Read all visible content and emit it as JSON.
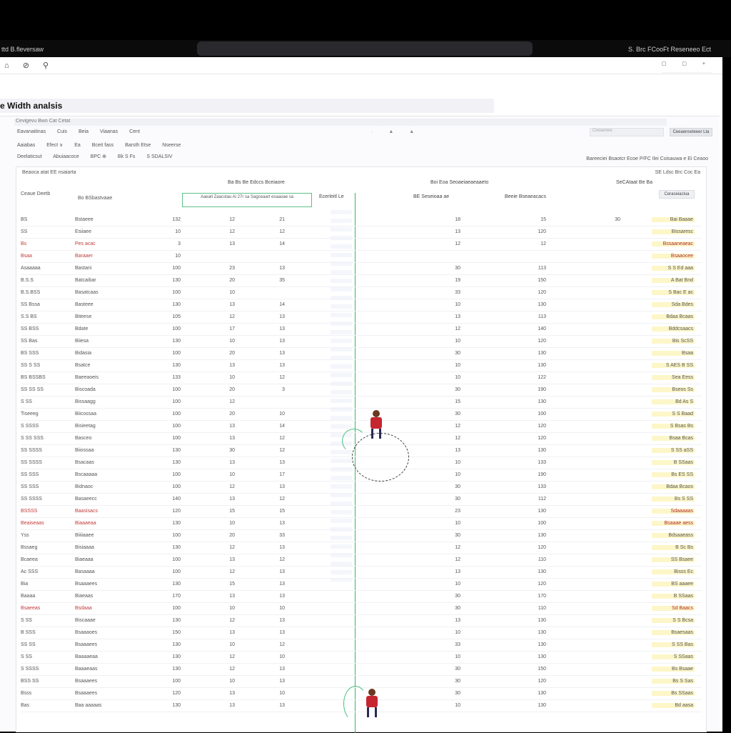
{
  "os_bar": {
    "left": "ttd B.fleversaw",
    "right": "S. Brc FCooFt Reseneeo  Ect"
  },
  "toolbar": {
    "left_icons": "⌂ ⊘ ⚲",
    "right_icons": "▢ ▢ +"
  },
  "page_title": "e Width analsis",
  "crumb": {
    "text": "Cevigevu Bwo Cat Cetat"
  },
  "filters_row1": [
    "Eavanaitinas",
    "Cuis",
    "Beia",
    "Viaanas",
    "Cent"
  ],
  "filters_row2": [
    "Aaiabas",
    "Efect ∨",
    "Ea",
    "Bceit fass",
    "Barsth Etse",
    "Nseerse"
  ],
  "filters_row3": [
    "Deelaticsut",
    "Abuiaacoce",
    "BPC ⊕",
    "Bk S Fs",
    "S SDALSIV"
  ],
  "search_placeholder": "Ceeaenee",
  "right_button": "Ceeaenseteeer Lta",
  "right_meta": "Bareeciei Bsaotcr Ecoe P/FC Ilei Coisauwa e Ei Ceaoo",
  "table": {
    "subhead": "Beaoca atat  EE nsaiarta",
    "subhead_right": "SE Ldsc Brc Coc Ea",
    "hdr3": "Ceaue Deetb",
    "header_button": "Ceraseiaclua",
    "green_box": "Aaeatl Zaacstau Ai 27r sa Sagceaart  esaaoae sa",
    "mid_header": "Ecerleitl Le",
    "col_header_a": "Bo BSbastvaae",
    "col_header_b": "BE Seseioaa ae",
    "col_header_c": "Ba Bs Be Edccs Bceiaore",
    "col_header_d": "Beeie Bseaeacacs",
    "col_header_e": "Boi Eoa Seoaeiaeaeaaeto",
    "col_header_f": "SeCAtaat Be Ba"
  },
  "rows": [
    {
      "a": "BS",
      "b": "Bstaeee",
      "c": "132",
      "d": "12",
      "e": "21",
      "f": "30",
      "g": "18",
      "h": "15",
      "score": "Bai Baaae",
      "red": false
    },
    {
      "a": "SS",
      "b": "Esiiaee",
      "c": "10",
      "d": "12",
      "e": "12",
      "f": "",
      "g": "13",
      "h": "120",
      "score": "Bissaresc",
      "red": false
    },
    {
      "a": "Bs",
      "b": "Pes acac",
      "c": "3",
      "d": "13",
      "e": "14",
      "f": "",
      "g": "12",
      "h": "12",
      "score": "Bssaaneaeac",
      "red": true
    },
    {
      "a": "Bsaa",
      "b": "Baraaer",
      "c": "10",
      "d": "",
      "e": "",
      "f": "",
      "g": "",
      "h": "",
      "score": "Bsaaocee",
      "red": true
    },
    {
      "a": "Asaaaaa",
      "b": "Bastani",
      "c": "100",
      "d": "23",
      "e": "13",
      "f": "",
      "g": "30",
      "h": "113",
      "score": "S S Ed aaa",
      "red": false
    },
    {
      "a": "B.S.S",
      "b": "Batcaibar",
      "c": "130",
      "d": "20",
      "e": "35",
      "f": "",
      "g": "19",
      "h": "150",
      "score": "A Bat Bnd",
      "red": false
    },
    {
      "a": "B.S.BSS",
      "b": "Basatcaas",
      "c": "100",
      "d": "10",
      "e": "",
      "f": "",
      "g": "33",
      "h": "120",
      "score": "S Bac E ac",
      "red": false
    },
    {
      "a": "SS Bssa",
      "b": "Basteee",
      "c": "130",
      "d": "13",
      "e": "14",
      "f": "",
      "g": "10",
      "h": "130",
      "score": "Sda Bdes",
      "red": false
    },
    {
      "a": "S.S BS",
      "b": "Biteese",
      "c": "105",
      "d": "12",
      "e": "13",
      "f": "",
      "g": "13",
      "h": "113",
      "score": "Bdaa Bcaas",
      "red": false
    },
    {
      "a": "SS BSS",
      "b": "Bdate",
      "c": "100",
      "d": "17",
      "e": "13",
      "f": "",
      "g": "12",
      "h": "140",
      "score": "Bddcsaacs",
      "red": false
    },
    {
      "a": "SS Bas",
      "b": "Biiesa",
      "c": "130",
      "d": "10",
      "e": "13",
      "f": "",
      "g": "10",
      "h": "120",
      "score": "Bis ScSS",
      "red": false
    },
    {
      "a": "BS SSS",
      "b": "Bidasia",
      "c": "100",
      "d": "20",
      "e": "13",
      "f": "",
      "g": "30",
      "h": "130",
      "score": "Bsaa",
      "red": false
    },
    {
      "a": "SS S SS",
      "b": "Bsatce",
      "c": "130",
      "d": "13",
      "e": "13",
      "f": "",
      "g": "10",
      "h": "130",
      "score": "S AES B SS",
      "red": false
    },
    {
      "a": "BS BSSBS",
      "b": "Baeeaoeis",
      "c": "133",
      "d": "10",
      "e": "12",
      "f": "",
      "g": "10",
      "h": "122",
      "score": "Sea Eess",
      "red": false
    },
    {
      "a": "SS SS SS",
      "b": "Biscoada",
      "c": "100",
      "d": "20",
      "e": "3",
      "f": "",
      "g": "30",
      "h": "190",
      "score": "Bseos Ss",
      "red": false
    },
    {
      "a": "S SS",
      "b": "Bissaagg",
      "c": "100",
      "d": "12",
      "e": "",
      "f": "",
      "g": "15",
      "h": "130",
      "score": "Bd As S",
      "red": false
    },
    {
      "a": "Tiseeeg",
      "b": "Biicossaa",
      "c": "100",
      "d": "20",
      "e": "10",
      "f": "",
      "g": "30",
      "h": "100",
      "score": "S S Baad",
      "red": false
    },
    {
      "a": "S SSSS",
      "b": "Bisieetag",
      "c": "100",
      "d": "13",
      "e": "14",
      "f": "",
      "g": "12",
      "h": "120",
      "score": "S Bsas Bs",
      "red": false
    },
    {
      "a": "S SS SSS",
      "b": "Basceo",
      "c": "100",
      "d": "13",
      "e": "12",
      "f": "",
      "g": "12",
      "h": "120",
      "score": "Bsaa Bcas",
      "red": false
    },
    {
      "a": "SS SSSS",
      "b": "Biiossaa",
      "c": "130",
      "d": "30",
      "e": "12",
      "f": "",
      "g": "13",
      "h": "130",
      "score": "S SS aSS",
      "red": false
    },
    {
      "a": "SS SSSS",
      "b": "Bsacaas",
      "c": "130",
      "d": "13",
      "e": "13",
      "f": "",
      "g": "10",
      "h": "133",
      "score": "B SSaas",
      "red": false
    },
    {
      "a": "SS SSS",
      "b": "Bscaaaaa",
      "c": "100",
      "d": "10",
      "e": "17",
      "f": "",
      "g": "10",
      "h": "190",
      "score": "Bs ES SS",
      "red": false
    },
    {
      "a": "SS SSS",
      "b": "Bidnaoc",
      "c": "100",
      "d": "12",
      "e": "13",
      "f": "",
      "g": "30",
      "h": "133",
      "score": "Bdaa Bcaos",
      "red": false
    },
    {
      "a": "SS SSSS",
      "b": "Basaeecc",
      "c": "140",
      "d": "13",
      "e": "12",
      "f": "",
      "g": "30",
      "h": "112",
      "score": "Bs S SS",
      "red": false
    },
    {
      "a": "BSSSS",
      "b": "Baasisacs",
      "c": "120",
      "d": "15",
      "e": "15",
      "f": "",
      "g": "23",
      "h": "130",
      "score": "Sdaaaaas",
      "red": true
    },
    {
      "a": "Beaiseaas",
      "b": "Biaaaeaa",
      "c": "130",
      "d": "10",
      "e": "13",
      "f": "",
      "g": "10",
      "h": "100",
      "score": "Bsaaae aess",
      "red": true
    },
    {
      "a": "Yss",
      "b": "Biiiiaaee",
      "c": "100",
      "d": "20",
      "e": "33",
      "f": "",
      "g": "30",
      "h": "130",
      "score": "Bdsaaeass",
      "red": false
    },
    {
      "a": "Bssaeg",
      "b": "Bisiaaaa",
      "c": "130",
      "d": "12",
      "e": "13",
      "f": "",
      "g": "12",
      "h": "120",
      "score": "B Sc Bs",
      "red": false
    },
    {
      "a": "Bcaeea",
      "b": "Biaeaaa",
      "c": "100",
      "d": "13",
      "e": "12",
      "f": "",
      "g": "12",
      "h": "110",
      "score": "SS Bsaee",
      "red": false
    },
    {
      "a": "Ac SSS",
      "b": "Basaaaa",
      "c": "100",
      "d": "12",
      "e": "13",
      "f": "",
      "g": "13",
      "h": "130",
      "score": "Bisss Ec",
      "red": false
    },
    {
      "a": "Bia",
      "b": "Bsaaaees",
      "c": "130",
      "d": "15",
      "e": "13",
      "f": "",
      "g": "10",
      "h": "120",
      "score": "BS aaaee",
      "red": false
    },
    {
      "a": "Baaaa",
      "b": "Biaeaas",
      "c": "170",
      "d": "13",
      "e": "13",
      "f": "",
      "g": "30",
      "h": "170",
      "score": "B SSaas",
      "red": false
    },
    {
      "a": "Bsaeeas",
      "b": "Bsdaaa",
      "c": "100",
      "d": "10",
      "e": "10",
      "f": "",
      "g": "30",
      "h": "110",
      "score": "Sd Baacs",
      "red": true
    },
    {
      "a": "S SS",
      "b": "Biscaaae",
      "c": "130",
      "d": "12",
      "e": "13",
      "f": "",
      "g": "13",
      "h": "130",
      "score": "S S Bcsa",
      "red": false
    },
    {
      "a": "B SSS",
      "b": "Bsaaaoes",
      "c": "150",
      "d": "13",
      "e": "13",
      "f": "",
      "g": "10",
      "h": "130",
      "score": "Bsaesaas",
      "red": false
    },
    {
      "a": "SS SS",
      "b": "Bsaaaees",
      "c": "130",
      "d": "10",
      "e": "12",
      "f": "",
      "g": "33",
      "h": "130",
      "score": "S SS Bas",
      "red": false
    },
    {
      "a": "S SS",
      "b": "Baaaaeaa",
      "c": "130",
      "d": "12",
      "e": "10",
      "f": "",
      "g": "10",
      "h": "130",
      "score": "S SSaas",
      "red": false
    },
    {
      "a": "S SSSS",
      "b": "Baaaeaas",
      "c": "130",
      "d": "12",
      "e": "13",
      "f": "",
      "g": "30",
      "h": "150",
      "score": "Bs Bsaae",
      "red": false
    },
    {
      "a": "BSS SS",
      "b": "Bsaaaees",
      "c": "100",
      "d": "10",
      "e": "13",
      "f": "",
      "g": "30",
      "h": "120",
      "score": "Bs S Sas",
      "red": false
    },
    {
      "a": "Bsss",
      "b": "Bsaaaees",
      "c": "120",
      "d": "13",
      "e": "10",
      "f": "",
      "g": "30",
      "h": "130",
      "score": "Bs SSaas",
      "red": false
    },
    {
      "a": "Bas",
      "b": "Baa aaaaas",
      "c": "130",
      "d": "13",
      "e": "13",
      "f": "",
      "g": "10",
      "h": "130",
      "score": "Bd aasa",
      "red": false
    }
  ]
}
